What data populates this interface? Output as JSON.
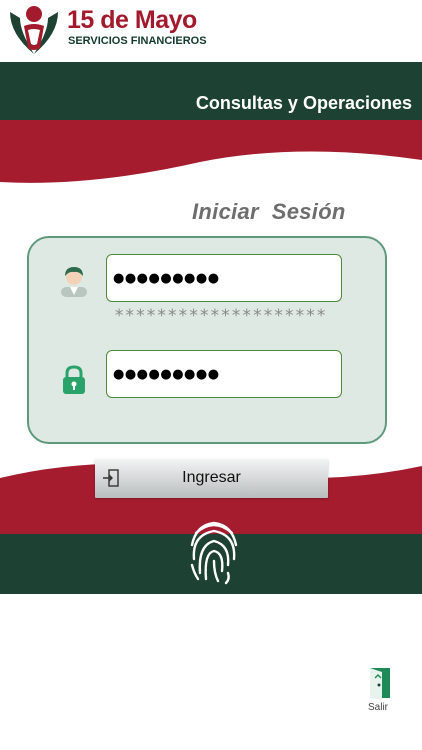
{
  "brand": {
    "name": "15 de Mayo",
    "subtitle": "SERVICIOS FINANCIEROS"
  },
  "header": {
    "title": "Consultas y Operaciones"
  },
  "login": {
    "title": "Iniciar  Sesión",
    "username_value": "●●●●●●●●●",
    "username_mask_hint": "********************",
    "password_value": "●●●●●●●●●",
    "submit_label": "Ingresar"
  },
  "footer": {
    "exit_label": "Salir"
  },
  "icons": {
    "logo": "logo-mark-icon",
    "user": "user-avatar-icon",
    "password": "padlock-icon",
    "submit": "sign-in-icon",
    "biometric": "fingerprint-icon",
    "exit": "exit-door-icon"
  },
  "colors": {
    "brand_red": "#a31a2c",
    "brand_green": "#1d4233",
    "card_bg": "#dfe9e4",
    "card_border": "#5f9a7d",
    "field_border": "#4f8a3a"
  }
}
